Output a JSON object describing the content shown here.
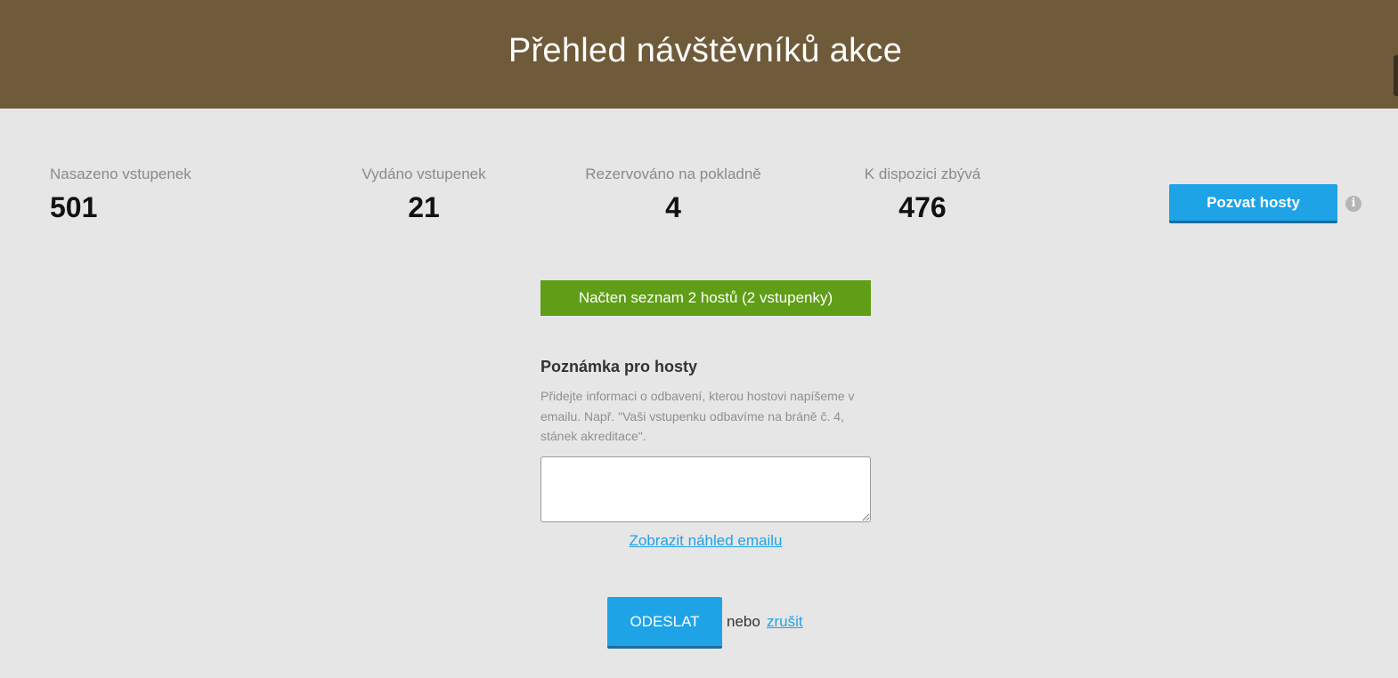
{
  "header": {
    "title": "Přehled návštěvníků akce"
  },
  "stats": [
    {
      "label": "Nasazeno vstupenek",
      "value": "501"
    },
    {
      "label": "Vydáno vstupenek",
      "value": "21"
    },
    {
      "label": "Rezervováno na pokladně",
      "value": "4"
    },
    {
      "label": "K dispozici zbývá",
      "value": "476"
    }
  ],
  "actions": {
    "invite_label": "Pozvat hosty",
    "info_icon": "i"
  },
  "notice": {
    "text": "Načten seznam 2 hostů (2 vstupenky)"
  },
  "note": {
    "title": "Poznámka pro hosty",
    "help": "Přidejte informaci o odbavení, kterou hostovi napíšeme v emailu. Např. \"Vaši vstupenku odbavíme na bráně č. 4, stánek akreditace\".",
    "value": "",
    "preview_link": "Zobrazit náhled emailu"
  },
  "form": {
    "send_label": "ODESLAT",
    "or_text": "nebo",
    "cancel_label": "zrušit"
  },
  "colors": {
    "header_bg": "#6f5b3a",
    "page_bg": "#e6e6e6",
    "accent": "#1ea3e6",
    "success": "#5f9e16"
  }
}
